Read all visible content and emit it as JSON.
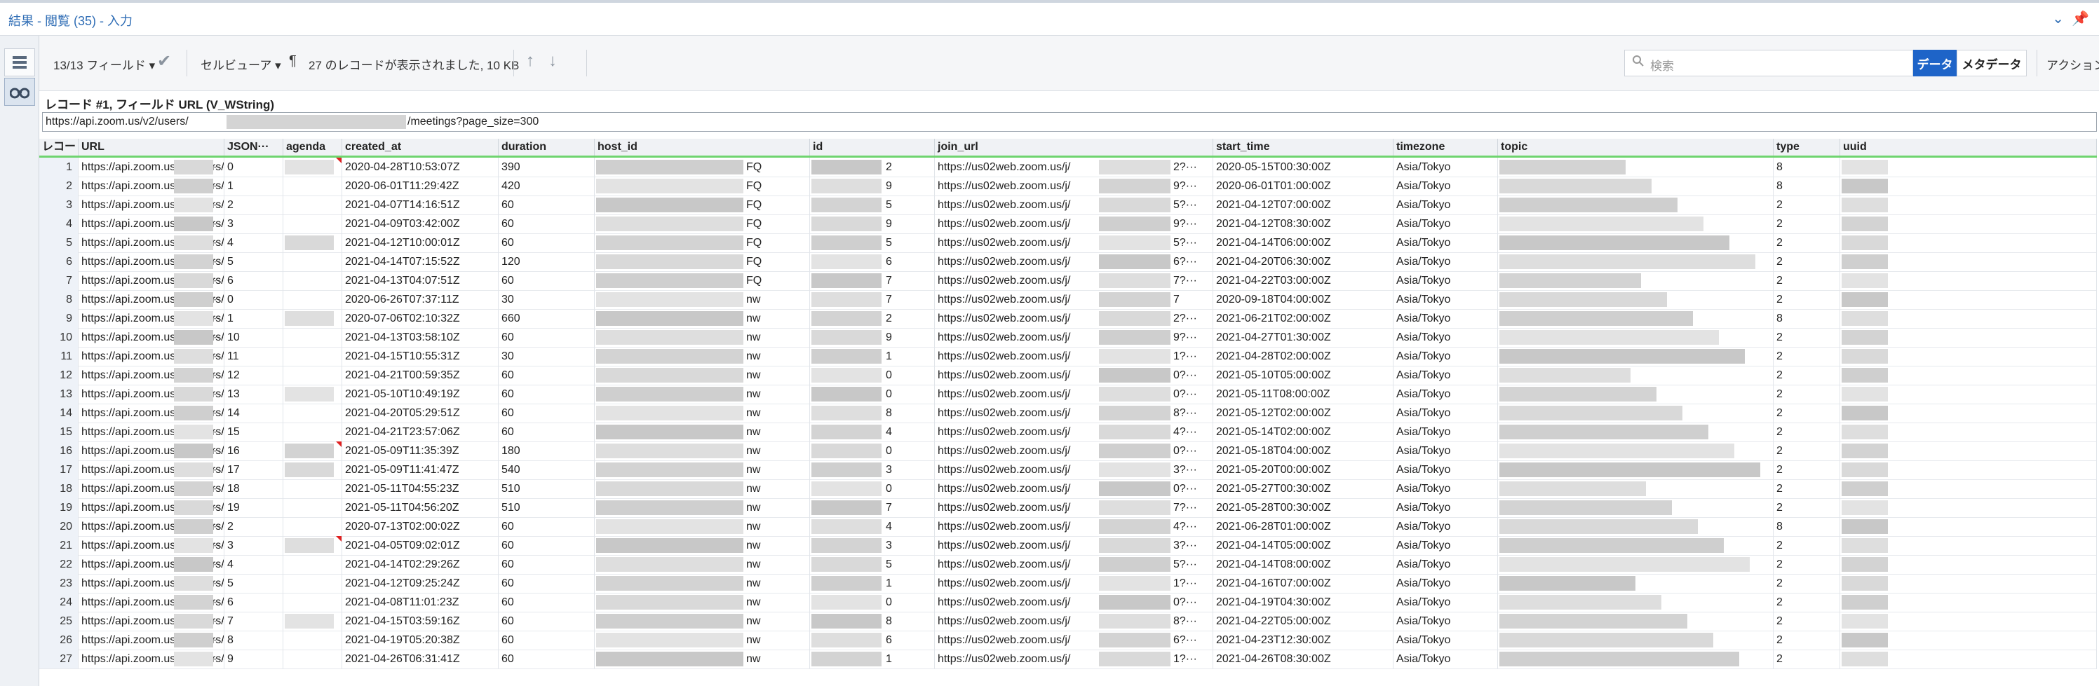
{
  "window": {
    "title": "結果 - 閲覧 (35) - 入力",
    "chevron": "⌄",
    "pin": "📌"
  },
  "toolbar": {
    "fields": "13/13 フィールド",
    "fields_caret": "▾",
    "check": "✔",
    "cellviewer": "セルビューア",
    "cellviewer_caret": "▾",
    "pilcrow": "¶",
    "status": "27 のレコードが表示されました, 10 KB",
    "up": "↑",
    "down": "↓",
    "search_placeholder": "検索",
    "btn_data": "データ",
    "btn_meta": "メタデータ",
    "actions": "アクション",
    "actions_caret": "▾"
  },
  "record_info": "レコード #1, フィールド URL (V_WString)",
  "url_bar": {
    "prefix": "https://api.zoom.us/v2/users/",
    "suffix": "/meetings?page_size=300"
  },
  "icons": {
    "list": "list-icon",
    "binoculars": "binoculars-icon",
    "search": "search-icon"
  },
  "columns": [
    {
      "key": "rec",
      "label": "レコード"
    },
    {
      "key": "url",
      "label": "URL"
    },
    {
      "key": "json",
      "label": "JSON···"
    },
    {
      "key": "agenda",
      "label": "agenda"
    },
    {
      "key": "created_at",
      "label": "created_at"
    },
    {
      "key": "duration",
      "label": "duration"
    },
    {
      "key": "host_id",
      "label": "host_id"
    },
    {
      "key": "id",
      "label": "id"
    },
    {
      "key": "join_url",
      "label": "join_url"
    },
    {
      "key": "start_time",
      "label": "start_time"
    },
    {
      "key": "timezone",
      "label": "timezone"
    },
    {
      "key": "topic",
      "label": "topic"
    },
    {
      "key": "type",
      "label": "type"
    },
    {
      "key": "uuid",
      "label": "uuid"
    }
  ],
  "cell_text": {
    "url_prefix": "https://api.zoom.us/v2/users/",
    "ellipsis": "···",
    "join_prefix": "https://us02web.zoom.us/j/",
    "timezone": "Asia/Tokyo"
  },
  "rows": [
    {
      "rec": "1",
      "json": "0",
      "agenda_flag": true,
      "created_at": "2020-04-28T10:53:07Z",
      "duration": "390",
      "host_tail": "FQ",
      "id_tail": "2",
      "join_tail": "2?···",
      "start_time": "2020-05-15T00:30:00Z",
      "type": "8"
    },
    {
      "rec": "2",
      "json": "1",
      "agenda_flag": false,
      "created_at": "2020-06-01T11:29:42Z",
      "duration": "420",
      "host_tail": "FQ",
      "id_tail": "9",
      "join_tail": "9?···",
      "start_time": "2020-06-01T01:00:00Z",
      "type": "8"
    },
    {
      "rec": "3",
      "json": "2",
      "agenda_flag": false,
      "created_at": "2021-04-07T14:16:51Z",
      "duration": "60",
      "host_tail": "FQ",
      "id_tail": "5",
      "join_tail": "5?···",
      "start_time": "2021-04-12T07:00:00Z",
      "type": "2"
    },
    {
      "rec": "4",
      "json": "3",
      "agenda_flag": false,
      "created_at": "2021-04-09T03:42:00Z",
      "duration": "60",
      "host_tail": "FQ",
      "id_tail": "9",
      "join_tail": "9?···",
      "start_time": "2021-04-12T08:30:00Z",
      "type": "2"
    },
    {
      "rec": "5",
      "json": "4",
      "agenda_flag": false,
      "created_at": "2021-04-12T10:00:01Z",
      "duration": "60",
      "host_tail": "FQ",
      "id_tail": "5",
      "join_tail": "5?···",
      "start_time": "2021-04-14T06:00:00Z",
      "type": "2"
    },
    {
      "rec": "6",
      "json": "5",
      "agenda_flag": false,
      "created_at": "2021-04-14T07:15:52Z",
      "duration": "120",
      "host_tail": "FQ",
      "id_tail": "6",
      "join_tail": "6?···",
      "start_time": "2021-04-20T06:30:00Z",
      "type": "2"
    },
    {
      "rec": "7",
      "json": "6",
      "agenda_flag": false,
      "created_at": "2021-04-13T04:07:51Z",
      "duration": "60",
      "host_tail": "FQ",
      "id_tail": "7",
      "join_tail": "7?···",
      "start_time": "2021-04-22T03:00:00Z",
      "type": "2"
    },
    {
      "rec": "8",
      "json": "0",
      "agenda_flag": false,
      "created_at": "2020-06-26T07:37:11Z",
      "duration": "30",
      "host_tail": "nw",
      "id_tail": "7",
      "join_tail": "7",
      "start_time": "2020-09-18T04:00:00Z",
      "type": "2"
    },
    {
      "rec": "9",
      "json": "1",
      "agenda_flag": false,
      "created_at": "2020-07-06T02:10:32Z",
      "duration": "660",
      "host_tail": "nw",
      "id_tail": "2",
      "join_tail": "2?···",
      "start_time": "2021-06-21T02:00:00Z",
      "type": "8"
    },
    {
      "rec": "10",
      "json": "10",
      "agenda_flag": false,
      "created_at": "2021-04-13T03:58:10Z",
      "duration": "60",
      "host_tail": "nw",
      "id_tail": "9",
      "join_tail": "9?···",
      "start_time": "2021-04-27T01:30:00Z",
      "type": "2"
    },
    {
      "rec": "11",
      "json": "11",
      "agenda_flag": false,
      "created_at": "2021-04-15T10:55:31Z",
      "duration": "30",
      "host_tail": "nw",
      "id_tail": "1",
      "join_tail": "1?···",
      "start_time": "2021-04-28T02:00:00Z",
      "type": "2"
    },
    {
      "rec": "12",
      "json": "12",
      "agenda_flag": false,
      "created_at": "2021-04-21T00:59:35Z",
      "duration": "60",
      "host_tail": "nw",
      "id_tail": "0",
      "join_tail": "0?···",
      "start_time": "2021-05-10T05:00:00Z",
      "type": "2"
    },
    {
      "rec": "13",
      "json": "13",
      "agenda_flag": false,
      "created_at": "2021-05-10T10:49:19Z",
      "duration": "60",
      "host_tail": "nw",
      "id_tail": "0",
      "join_tail": "0?···",
      "start_time": "2021-05-11T08:00:00Z",
      "type": "2"
    },
    {
      "rec": "14",
      "json": "14",
      "agenda_flag": false,
      "created_at": "2021-04-20T05:29:51Z",
      "duration": "60",
      "host_tail": "nw",
      "id_tail": "8",
      "join_tail": "8?···",
      "start_time": "2021-05-12T02:00:00Z",
      "type": "2"
    },
    {
      "rec": "15",
      "json": "15",
      "agenda_flag": false,
      "created_at": "2021-04-21T23:57:06Z",
      "duration": "60",
      "host_tail": "nw",
      "id_tail": "4",
      "join_tail": "4?···",
      "start_time": "2021-05-14T02:00:00Z",
      "type": "2"
    },
    {
      "rec": "16",
      "json": "16",
      "agenda_flag": true,
      "created_at": "2021-05-09T11:35:39Z",
      "duration": "180",
      "host_tail": "nw",
      "id_tail": "0",
      "join_tail": "0?···",
      "start_time": "2021-05-18T04:00:00Z",
      "type": "2"
    },
    {
      "rec": "17",
      "json": "17",
      "agenda_flag": false,
      "created_at": "2021-05-09T11:41:47Z",
      "duration": "540",
      "host_tail": "nw",
      "id_tail": "3",
      "join_tail": "3?···",
      "start_time": "2021-05-20T00:00:00Z",
      "type": "2"
    },
    {
      "rec": "18",
      "json": "18",
      "agenda_flag": false,
      "created_at": "2021-05-11T04:55:23Z",
      "duration": "510",
      "host_tail": "nw",
      "id_tail": "0",
      "join_tail": "0?···",
      "start_time": "2021-05-27T00:30:00Z",
      "type": "2"
    },
    {
      "rec": "19",
      "json": "19",
      "agenda_flag": false,
      "created_at": "2021-05-11T04:56:20Z",
      "duration": "510",
      "host_tail": "nw",
      "id_tail": "7",
      "join_tail": "7?···",
      "start_time": "2021-05-28T00:30:00Z",
      "type": "2"
    },
    {
      "rec": "20",
      "json": "2",
      "agenda_flag": false,
      "created_at": "2020-07-13T02:00:02Z",
      "duration": "60",
      "host_tail": "nw",
      "id_tail": "4",
      "join_tail": "4?···",
      "start_time": "2021-06-28T01:00:00Z",
      "type": "8"
    },
    {
      "rec": "21",
      "json": "3",
      "agenda_flag": true,
      "created_at": "2021-04-05T09:02:01Z",
      "duration": "60",
      "host_tail": "nw",
      "id_tail": "3",
      "join_tail": "3?···",
      "start_time": "2021-04-14T05:00:00Z",
      "type": "2"
    },
    {
      "rec": "22",
      "json": "4",
      "agenda_flag": false,
      "created_at": "2021-04-14T02:29:26Z",
      "duration": "60",
      "host_tail": "nw",
      "id_tail": "5",
      "join_tail": "5?···",
      "start_time": "2021-04-14T08:00:00Z",
      "type": "2"
    },
    {
      "rec": "23",
      "json": "5",
      "agenda_flag": false,
      "created_at": "2021-04-12T09:25:24Z",
      "duration": "60",
      "host_tail": "nw",
      "id_tail": "1",
      "join_tail": "1?···",
      "start_time": "2021-04-16T07:00:00Z",
      "type": "2"
    },
    {
      "rec": "24",
      "json": "6",
      "agenda_flag": false,
      "created_at": "2021-04-08T11:01:23Z",
      "duration": "60",
      "host_tail": "nw",
      "id_tail": "0",
      "join_tail": "0?···",
      "start_time": "2021-04-19T04:30:00Z",
      "type": "2"
    },
    {
      "rec": "25",
      "json": "7",
      "agenda_flag": false,
      "created_at": "2021-04-15T03:59:16Z",
      "duration": "60",
      "host_tail": "nw",
      "id_tail": "8",
      "join_tail": "8?···",
      "start_time": "2021-04-22T05:00:00Z",
      "type": "2"
    },
    {
      "rec": "26",
      "json": "8",
      "agenda_flag": false,
      "created_at": "2021-04-19T05:20:38Z",
      "duration": "60",
      "host_tail": "nw",
      "id_tail": "6",
      "join_tail": "6?···",
      "start_time": "2021-04-23T12:30:00Z",
      "type": "2"
    },
    {
      "rec": "27",
      "json": "9",
      "agenda_flag": false,
      "created_at": "2021-04-26T06:31:41Z",
      "duration": "60",
      "host_tail": "nw",
      "id_tail": "1",
      "join_tail": "1?···",
      "start_time": "2021-04-26T08:30:00Z",
      "type": "2"
    }
  ]
}
